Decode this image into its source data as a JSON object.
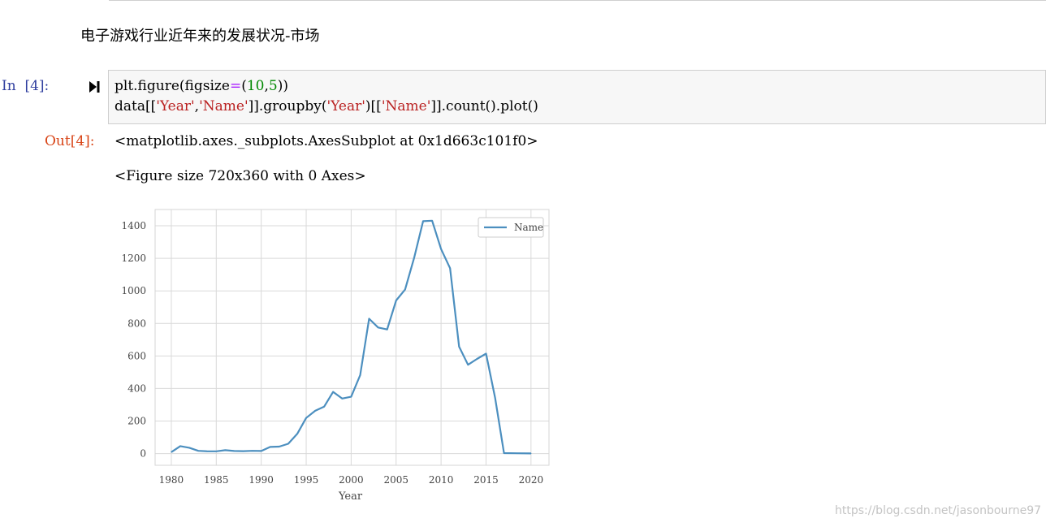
{
  "markdown": {
    "heading": "电子游戏行业近年来的发展状况-市场"
  },
  "code_cell": {
    "prompt": "In  [4]:",
    "line1": {
      "a": "plt.figure(figsize",
      "op": "=",
      "b": "(",
      "n1": "10",
      "c": ",",
      "n2": "5",
      "d": "))"
    },
    "line2": {
      "a": "data[[",
      "s1": "'Year'",
      "b": ",",
      "s2": "'Name'",
      "c": "]].groupby(",
      "s3": "'Year'",
      "d": ")[[",
      "s4": "'Name'",
      "e": "]].count().plot()"
    }
  },
  "output": {
    "prompt": "Out[4]:",
    "line1": "<matplotlib.axes._subplots.AxesSubplot at 0x1d663c101f0>",
    "line2": "<Figure size 720x360 with 0 Axes>"
  },
  "chart_data": {
    "type": "line",
    "title": "",
    "xlabel": "Year",
    "ylabel": "",
    "xlim": [
      1978.2,
      2022.0
    ],
    "ylim": [
      -72,
      1500
    ],
    "xticks": [
      1980,
      1985,
      1990,
      1995,
      2000,
      2005,
      2010,
      2015,
      2020
    ],
    "yticks": [
      0,
      200,
      400,
      600,
      800,
      1000,
      1200,
      1400
    ],
    "grid": true,
    "legend_position": "top-right",
    "line_color": "#4c8fbf",
    "series": [
      {
        "name": "Name",
        "x": [
          1980,
          1981,
          1982,
          1983,
          1984,
          1985,
          1986,
          1987,
          1988,
          1989,
          1990,
          1991,
          1992,
          1993,
          1994,
          1995,
          1996,
          1997,
          1998,
          1999,
          2000,
          2001,
          2002,
          2003,
          2004,
          2005,
          2006,
          2007,
          2008,
          2009,
          2010,
          2011,
          2012,
          2013,
          2014,
          2015,
          2016,
          2017,
          2020
        ],
        "y": [
          9,
          46,
          36,
          17,
          14,
          14,
          21,
          16,
          15,
          17,
          16,
          41,
          43,
          60,
          121,
          219,
          263,
          289,
          379,
          338,
          349,
          482,
          829,
          775,
          763,
          941,
          1008,
          1202,
          1428,
          1431,
          1257,
          1139,
          657,
          546,
          582,
          614,
          344,
          3,
          1
        ]
      }
    ]
  },
  "watermark": "https://blog.csdn.net/jasonbourne97"
}
